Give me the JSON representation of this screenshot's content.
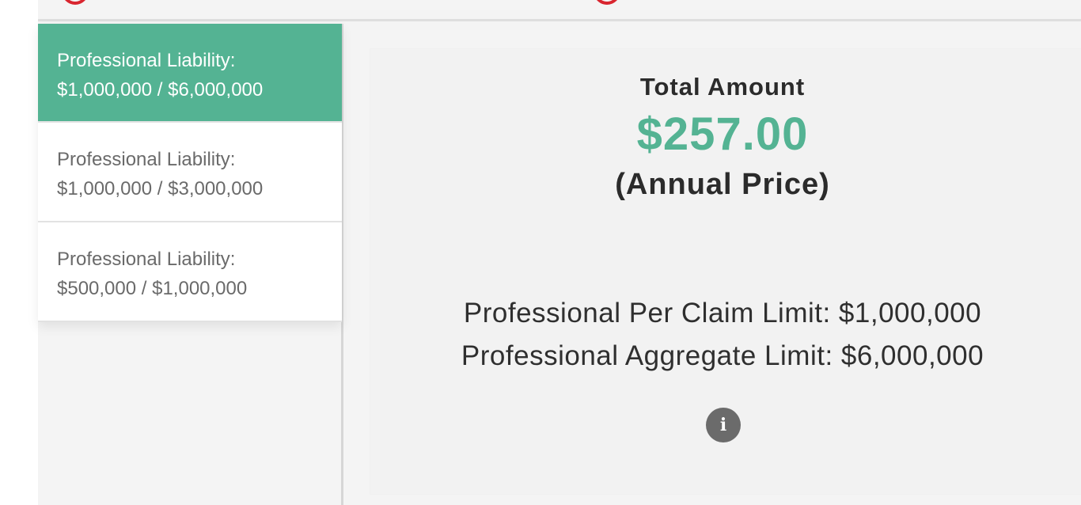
{
  "options": [
    {
      "line1": "Professional Liability:",
      "line2": "$1,000,000 / $6,000,000",
      "active": true
    },
    {
      "line1": "Professional Liability:",
      "line2": "$1,000,000 / $3,000,000",
      "active": false
    },
    {
      "line1": "Professional Liability:",
      "line2": "$500,000 / $1,000,000",
      "active": false
    }
  ],
  "summary": {
    "total_label": "Total Amount",
    "total_value": "$257.00",
    "period": "(Annual Price)",
    "per_claim": "Professional Per Claim Limit: $1,000,000",
    "aggregate": "Professional Aggregate Limit: $6,000,000",
    "info_icon": "info-icon",
    "info_glyph": "i"
  },
  "colors": {
    "accent": "#54b393",
    "top_decoration": "#d9252f",
    "info_button": "#6b6b6b"
  }
}
